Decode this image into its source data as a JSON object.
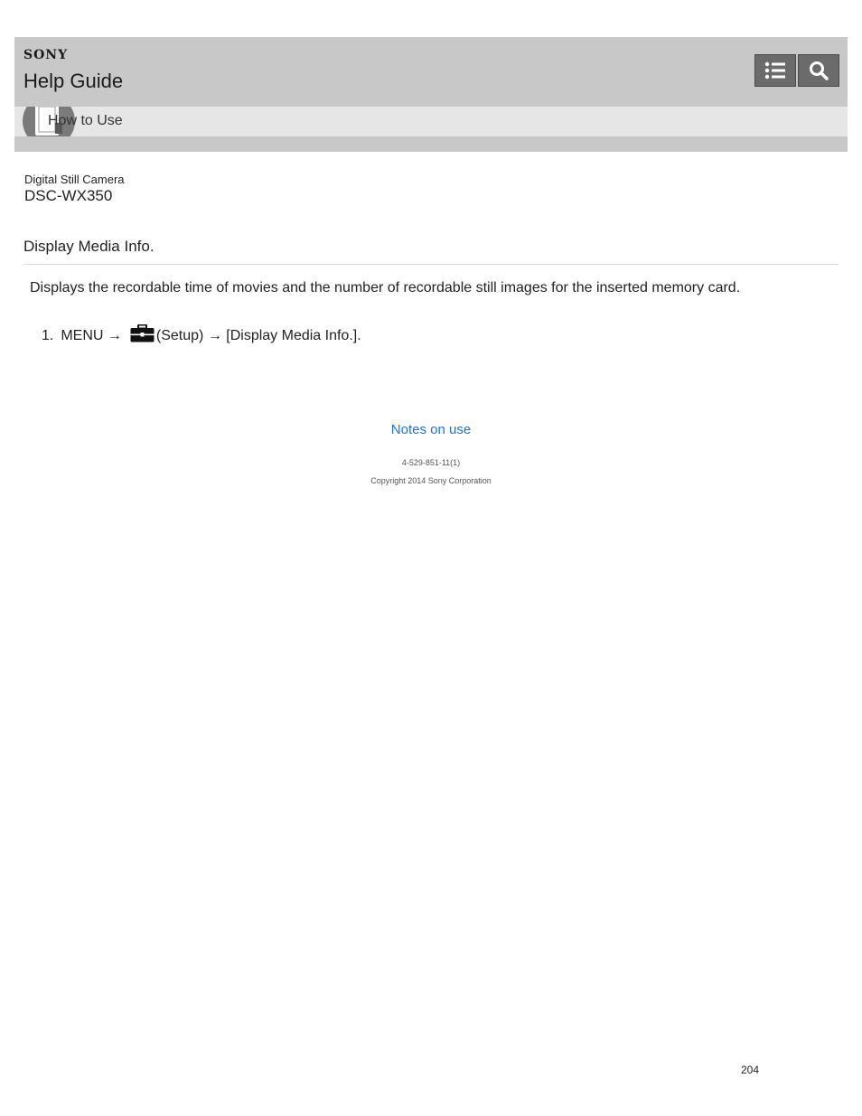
{
  "header": {
    "brand": "SONY",
    "title": "Help Guide",
    "buttons": [
      {
        "icon": "list-icon"
      },
      {
        "icon": "search-icon"
      }
    ]
  },
  "breadcrumb": {
    "label": "How to Use",
    "icon": "manual-book-icon"
  },
  "product": {
    "category": "Digital Still Camera",
    "model": "DSC-WX350"
  },
  "topic": {
    "title": "Display Media Info.",
    "description": "Displays the recordable time of movies and the number of recordable still images for the inserted memory card.",
    "steps": [
      {
        "number": "1.",
        "prefix": "MENU →",
        "icon": "toolbox-icon",
        "suffix": "(Setup) → [Display Media Info.]."
      }
    ]
  },
  "footer": {
    "link": "Notes on use",
    "doc_code": "4-529-851-11(1)",
    "copyright": "Copyright 2014 Sony Corporation",
    "page_number": "204"
  },
  "colors": {
    "header_bg": "#c8c8c8",
    "subbar_bg": "#e6e6e6",
    "button_bg": "#6b6b6b",
    "link": "#1a73e8"
  }
}
